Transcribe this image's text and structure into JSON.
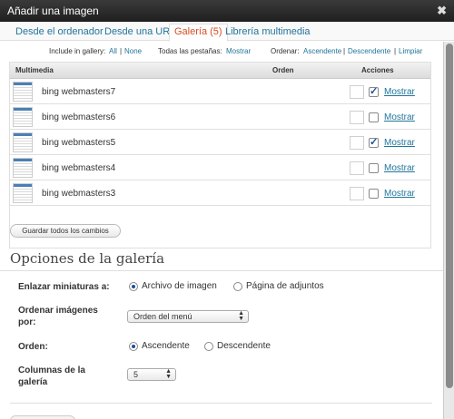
{
  "window": {
    "title": "Añadir una imagen",
    "close_label": "✖"
  },
  "tabs": [
    {
      "label": "Desde el ordenador",
      "active": false
    },
    {
      "label": "Desde una URL",
      "active": false
    },
    {
      "label": "Galería (5)",
      "active": true
    },
    {
      "label": "Librería multimedia",
      "active": false
    }
  ],
  "filters": {
    "include_label": "Include in gallery:",
    "all": "All",
    "sep1": "|",
    "none": "None",
    "tabs_label": "Todas las pestañas:",
    "show": "Mostrar",
    "order_label": "Ordenar:",
    "asc": "Ascendente",
    "sep2": "|",
    "desc": "Descendente",
    "sep3": "|",
    "clear": "Limpiar"
  },
  "table": {
    "headers": {
      "media": "Multimedia",
      "order": "Orden",
      "actions": "Acciones"
    },
    "rows": [
      {
        "name": "bing webmasters7",
        "checked": true,
        "action": "Mostrar"
      },
      {
        "name": "bing webmasters6",
        "checked": false,
        "action": "Mostrar"
      },
      {
        "name": "bing webmasters5",
        "checked": true,
        "action": "Mostrar"
      },
      {
        "name": "bing webmasters4",
        "checked": false,
        "action": "Mostrar"
      },
      {
        "name": "bing webmasters3",
        "checked": false,
        "action": "Mostrar"
      }
    ],
    "check_glyph": "✓"
  },
  "save_button": "Guardar todos los cambios",
  "gallery_options": {
    "title": "Opciones de la galería",
    "link_label": "Enlazar miniaturas a:",
    "link_option_file": "Archivo de imagen",
    "link_option_page": "Página de adjuntos",
    "order_images_label_1": "Ordenar imágenes",
    "order_images_label_2": "por:",
    "order_images_value": "Orden del menú",
    "order_label": "Orden:",
    "order_asc": "Ascendente",
    "order_desc": "Descendente",
    "columns_label_1": "Columnas de la",
    "columns_label_2": "galería",
    "columns_value": "5"
  },
  "icons": {
    "close": "close-icon",
    "check": "checkmark-icon",
    "select_arrows": "select-arrows-icon"
  }
}
